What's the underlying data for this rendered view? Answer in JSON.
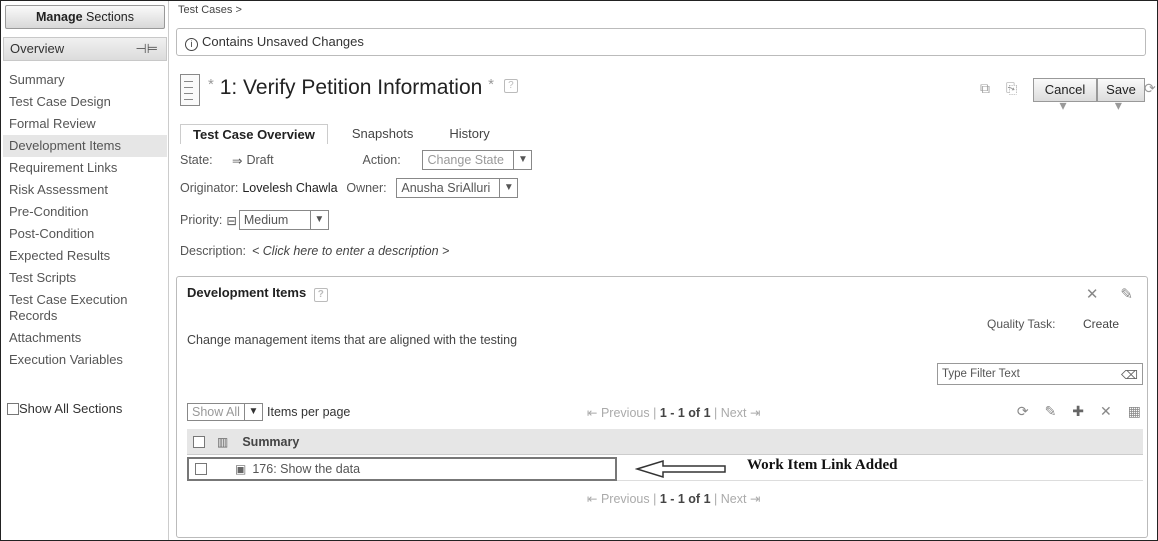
{
  "sidebar": {
    "manage_prefix": "Manage",
    "manage_suffix": " Sections",
    "overview": "Overview",
    "items": [
      {
        "label": "Summary"
      },
      {
        "label": "Test Case Design"
      },
      {
        "label": "Formal Review"
      },
      {
        "label": "Development Items"
      },
      {
        "label": "Requirement Links"
      },
      {
        "label": "Risk Assessment"
      },
      {
        "label": "Pre-Condition"
      },
      {
        "label": "Post-Condition"
      },
      {
        "label": "Expected Results"
      },
      {
        "label": "Test Scripts"
      },
      {
        "label": "Test Case Execution Records"
      },
      {
        "label": "Attachments"
      },
      {
        "label": "Execution Variables"
      }
    ],
    "show_all": "Show All Sections"
  },
  "breadcrumb": "Test Cases >",
  "banner": {
    "info_glyph": "i",
    "text": "Contains Unsaved Changes"
  },
  "title": {
    "prefix": "*",
    "text": "1: Verify Petition Information",
    "suffix": "*",
    "help": "?"
  },
  "buttons": {
    "cancel": "Cancel",
    "save": "Save"
  },
  "tabs": [
    {
      "label": "Test Case Overview",
      "active": true
    },
    {
      "label": "Snapshots"
    },
    {
      "label": "History"
    }
  ],
  "fields": {
    "state_label": "State:",
    "state_value": "Draft",
    "action_label": "Action:",
    "action_value": "Change State",
    "originator_label": "Originator:",
    "originator_value": "Lovelesh Chawla",
    "owner_label": "Owner:",
    "owner_value": "Anusha SriAlluri",
    "priority_label": "Priority:",
    "priority_value": "Medium",
    "description_label": "Description:",
    "description_value": "< Click here to enter a description >"
  },
  "panel": {
    "title": "Development Items",
    "help": "?",
    "quality_task": "Quality Task:",
    "create": "Create",
    "description": "Change management items that are aligned with the testing",
    "filter_placeholder": "Type Filter Text",
    "show_all": "Show All",
    "items_per_page": "Items per page",
    "pager": {
      "previous": "Previous",
      "range": "1 - 1 of 1",
      "next": "Next"
    },
    "column_summary": "Summary",
    "rows": [
      {
        "summary": "176: Show the data"
      }
    ],
    "annotation": "Work Item Link Added"
  }
}
